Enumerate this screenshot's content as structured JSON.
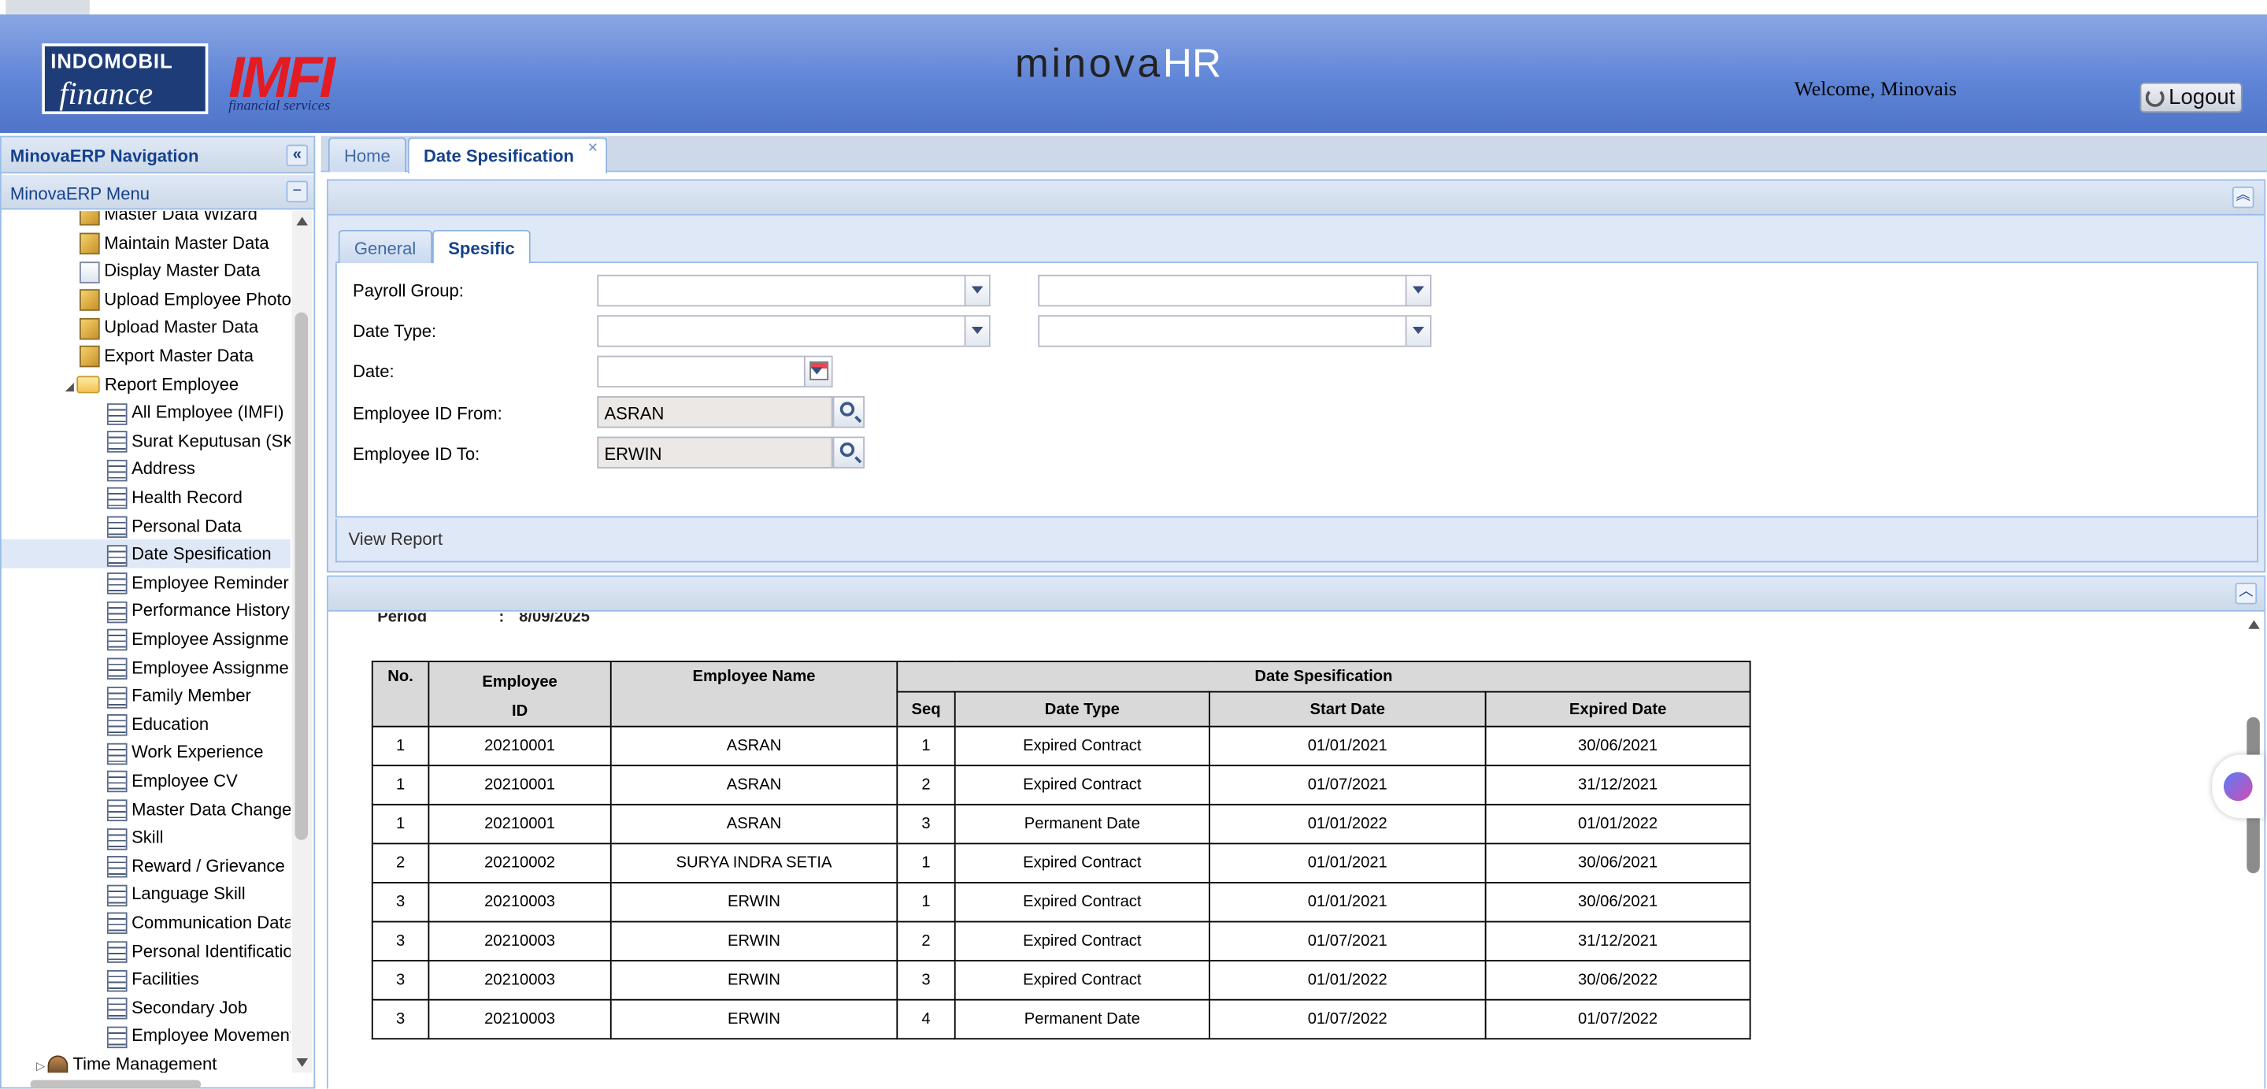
{
  "header": {
    "company_logo_line1": "INDOMOBIL",
    "company_logo_line2": "finance",
    "imfi_logo_text": "IMFI",
    "imfi_logo_sub": "financial services",
    "brand_part1": "minova",
    "brand_part2": "HR",
    "welcome": "Welcome, Minovais",
    "logout": "Logout"
  },
  "nav": {
    "title": "MinovaERP Navigation",
    "menu_title": "MinovaERP Menu",
    "items": [
      {
        "label": "Master Data Wizard",
        "icon": "edit-icon"
      },
      {
        "label": "Maintain Master Data",
        "icon": "edit-icon"
      },
      {
        "label": "Display Master Data",
        "icon": "display-icon"
      },
      {
        "label": "Upload Employee Photo",
        "icon": "edit-icon"
      },
      {
        "label": "Upload Master Data",
        "icon": "edit-icon"
      },
      {
        "label": "Export Master Data",
        "icon": "edit-icon"
      },
      {
        "label": "Report Employee",
        "icon": "folder-icon"
      },
      {
        "label": "All Employee (IMFI)",
        "icon": "report-icon"
      },
      {
        "label": "Surat Keputusan (SK)",
        "icon": "report-icon"
      },
      {
        "label": "Address",
        "icon": "report-icon"
      },
      {
        "label": "Health Record",
        "icon": "report-icon"
      },
      {
        "label": "Personal Data",
        "icon": "report-icon"
      },
      {
        "label": "Date Spesification",
        "icon": "report-icon"
      },
      {
        "label": "Employee Reminder",
        "icon": "report-icon"
      },
      {
        "label": "Performance History",
        "icon": "report-icon"
      },
      {
        "label": "Employee Assignme",
        "icon": "report-icon"
      },
      {
        "label": "Employee Assignme",
        "icon": "report-icon"
      },
      {
        "label": "Family Member",
        "icon": "report-icon"
      },
      {
        "label": "Education",
        "icon": "report-icon"
      },
      {
        "label": "Work Experience",
        "icon": "report-icon"
      },
      {
        "label": "Employee CV",
        "icon": "report-icon"
      },
      {
        "label": "Master Data Change",
        "icon": "report-icon"
      },
      {
        "label": "Skill",
        "icon": "report-icon"
      },
      {
        "label": "Reward / Grievance",
        "icon": "report-icon"
      },
      {
        "label": "Language Skill",
        "icon": "report-icon"
      },
      {
        "label": "Communication Data",
        "icon": "report-icon"
      },
      {
        "label": "Personal Identification",
        "icon": "report-icon"
      },
      {
        "label": "Facilities",
        "icon": "report-icon"
      },
      {
        "label": "Secondary Job",
        "icon": "report-icon"
      },
      {
        "label": "Employee Movement",
        "icon": "report-icon"
      },
      {
        "label": "Time Management",
        "icon": "person-icon"
      }
    ],
    "selected": "Date Spesification"
  },
  "tabs": [
    {
      "label": "Home"
    },
    {
      "label": "Date Spesification"
    }
  ],
  "form": {
    "tabs": [
      "General",
      "Spesific"
    ],
    "payroll_group_label": "Payroll Group:",
    "date_type_label": "Date Type:",
    "date_label": "Date:",
    "emp_from_label": "Employee ID From:",
    "emp_from_value": "ASRAN",
    "emp_to_label": "Employee ID To:",
    "emp_to_value": "ERWIN",
    "view_report": "View Report"
  },
  "report": {
    "period_label": "Period",
    "period_colon": ":",
    "period_value": "8/09/2025",
    "headers": {
      "no": "No.",
      "emp_id_line1": "Employee",
      "emp_id_line2": "ID",
      "emp_name": "Employee Name",
      "group": "Date Spesification",
      "seq": "Seq",
      "date_type": "Date Type",
      "start_date": "Start Date",
      "expired_date": "Expired Date"
    },
    "rows": [
      [
        "1",
        "20210001",
        "ASRAN",
        "1",
        "Expired Contract",
        "01/01/2021",
        "30/06/2021"
      ],
      [
        "1",
        "20210001",
        "ASRAN",
        "2",
        "Expired Contract",
        "01/07/2021",
        "31/12/2021"
      ],
      [
        "1",
        "20210001",
        "ASRAN",
        "3",
        "Permanent Date",
        "01/01/2022",
        "01/01/2022"
      ],
      [
        "2",
        "20210002",
        "SURYA INDRA SETIA",
        "1",
        "Expired Contract",
        "01/01/2021",
        "30/06/2021"
      ],
      [
        "3",
        "20210003",
        "ERWIN",
        "1",
        "Expired Contract",
        "01/01/2021",
        "30/06/2021"
      ],
      [
        "3",
        "20210003",
        "ERWIN",
        "2",
        "Expired Contract",
        "01/07/2021",
        "31/12/2021"
      ],
      [
        "3",
        "20210003",
        "ERWIN",
        "3",
        "Expired Contract",
        "01/01/2022",
        "30/06/2022"
      ],
      [
        "3",
        "20210003",
        "ERWIN",
        "4",
        "Permanent Date",
        "01/07/2022",
        "01/07/2022"
      ]
    ]
  }
}
